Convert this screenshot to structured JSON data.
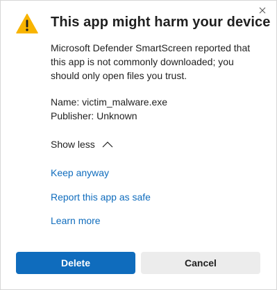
{
  "dialog": {
    "title": "This app might harm your device",
    "message": "Microsoft Defender SmartScreen reported that this app is not commonly downloaded; you should only open files you trust.",
    "name_line": "Name: victim_malware.exe",
    "publisher_line": "Publisher: Unknown",
    "toggle_label": "Show less",
    "links": {
      "keep_anyway": "Keep anyway",
      "report_safe": "Report this app as safe",
      "learn_more": "Learn more"
    },
    "buttons": {
      "delete": "Delete",
      "cancel": "Cancel"
    }
  },
  "icons": {
    "warning": "warning-icon",
    "close": "close-icon",
    "chevron": "chevron-up-icon"
  },
  "colors": {
    "accent": "#0f6cbd",
    "warning": "#f8b400",
    "secondary_button": "#ececec"
  }
}
